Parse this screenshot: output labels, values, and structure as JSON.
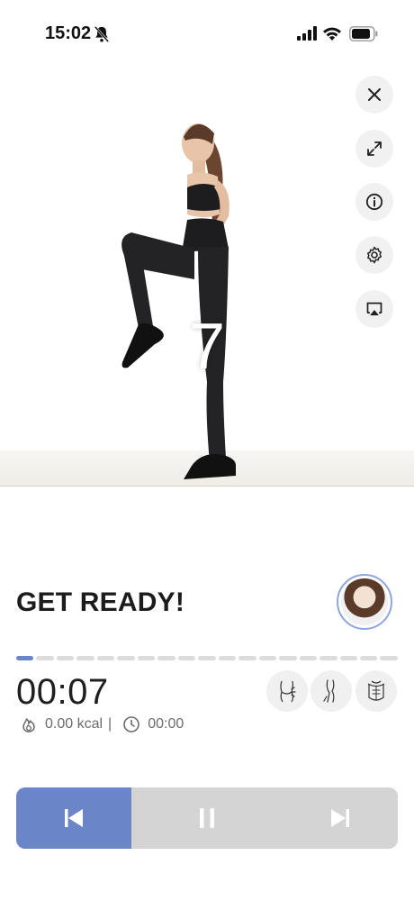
{
  "status_bar": {
    "time": "15:02",
    "icons": [
      "bell-slash-icon",
      "cellular-signal-icon",
      "wifi-icon",
      "battery-icon"
    ]
  },
  "video": {
    "countdown": "7",
    "side_buttons": [
      "close-icon",
      "expand-icon",
      "info-icon",
      "settings-gear-icon",
      "airplay-icon"
    ]
  },
  "workout": {
    "title": "GET READY!",
    "timer": "00:07",
    "calories": "0.00 kcal",
    "separator": "|",
    "duration": "00:00",
    "progress": {
      "total_segments": 19,
      "active_segment": 1
    },
    "muscle_groups": [
      "glutes-icon",
      "legs-icon",
      "core-icon"
    ]
  },
  "controls": [
    "previous-icon",
    "pause-icon",
    "next-icon"
  ],
  "colors": {
    "accent": "#6a86c8",
    "control_bg": "#d4d4d4",
    "segment_inactive": "#dcdcdc"
  }
}
